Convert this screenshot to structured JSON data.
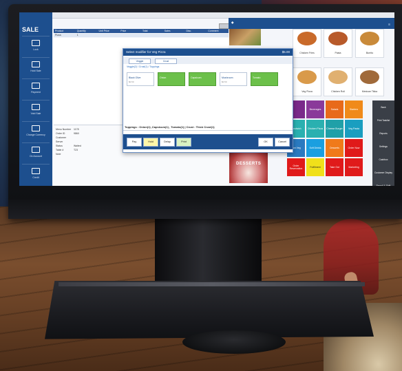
{
  "screen": {
    "app_title": "SALE",
    "top_caption": "",
    "sidebar": [
      {
        "label": "Lock",
        "icon": "cash-register-icon"
      },
      {
        "label": "Hold Sale",
        "icon": "hold-icon"
      },
      {
        "label": "Payment",
        "icon": "payment-icon"
      },
      {
        "label": "Void Sale",
        "icon": "void-icon"
      },
      {
        "label": "Change Currency",
        "icon": "grid-icon"
      },
      {
        "label": "On Account",
        "icon": "account-icon"
      },
      {
        "label": "Credit",
        "icon": "card-icon"
      }
    ],
    "order_table": {
      "headers": [
        "Product",
        "Quantity",
        "Unit Price",
        "Price",
        "Total",
        "Sales",
        "Disc.",
        "Comment"
      ],
      "rows": [
        [
          "Pizza",
          "1",
          "",
          "",
          "",
          "",
          "",
          ""
        ]
      ]
    },
    "info_panel": [
      {
        "label": "Menu Number",
        "value": "1178"
      },
      {
        "label": "Order ID",
        "value": "9860"
      },
      {
        "label": "Customer",
        "value": ""
      },
      {
        "label": "Server",
        "value": ""
      },
      {
        "label": "Status",
        "value": "Waited"
      },
      {
        "label": "Table #",
        "value": "T23"
      },
      {
        "label": "Note",
        "value": ""
      }
    ],
    "modal": {
      "title": "Select modifier for Veg Pizza",
      "price": "$5.00",
      "tabs": [
        "Veggie",
        "Crust"
      ],
      "breadcrumb": "Veggie(2) / Crust(1) / Toppings",
      "options": [
        {
          "name": "Black Olive",
          "price": "$0.50",
          "selected": false
        },
        {
          "name": "Onion",
          "price": "",
          "selected": true
        },
        {
          "name": "Capsicum",
          "price": "",
          "selected": true
        },
        {
          "name": "Mushroom",
          "price": "$0.50",
          "selected": false
        },
        {
          "name": "Tomato",
          "price": "",
          "selected": true
        }
      ],
      "summary": "Toppings : Onion(1) ,Capsicum(1) , Tomato(1)  | Crust : Thick Crust(1)",
      "actions_left": [
        "Pay",
        "Hold",
        "Delay",
        "Print"
      ],
      "actions_right": [
        "OK",
        "Cancel"
      ]
    },
    "product_panel": {
      "foods": [
        {
          "name": "",
          "color": "#8a4a2a"
        },
        {
          "name": "Chicken Fries",
          "color": "#c96a2a"
        },
        {
          "name": "Pasta",
          "color": "#b85a2a"
        },
        {
          "name": "Burrito",
          "color": "#c98a3a"
        },
        {
          "name": "Veg Pizza",
          "color": "#d99a4a"
        },
        {
          "name": "Chicken Roll",
          "color": "#e0b070"
        },
        {
          "name": "Mexican Tikka",
          "color": "#a06a3a"
        }
      ],
      "categories": [
        {
          "label": "",
          "color": "#7a2a8a"
        },
        {
          "label": "Beverages",
          "color": "#8a3a9a"
        },
        {
          "label": "Salads",
          "color": "#e86a1a"
        },
        {
          "label": "Starters",
          "color": "#f08a1a"
        },
        {
          "label": "Sandwich",
          "color": "#2ab0b0"
        },
        {
          "label": "Chicken Pizza",
          "color": "#2ab0b0"
        },
        {
          "label": "Cheese Burger",
          "color": "#20a0a8"
        },
        {
          "label": "Veg Pasta",
          "color": "#1a9ec0"
        },
        {
          "label": "Non Veg",
          "color": "#2a7ac0"
        },
        {
          "label": "Soft Drinks",
          "color": "#1a9fe0"
        },
        {
          "label": "Desserts",
          "color": "#f07a1a"
        },
        {
          "label": "Order Now",
          "color": "#e01a1a"
        },
        {
          "label": "Order Reservation",
          "color": "#e01a1a"
        },
        {
          "label": "Fulfilment",
          "color": "#f0e01a"
        },
        {
          "label": "Take Out",
          "color": "#e01a1a"
        },
        {
          "label": "Marketing",
          "color": "#e01a1a"
        }
      ],
      "side_commands": [
        "Back",
        "Print Tasklist",
        "Reports",
        "Settings",
        "Cashbox",
        "Customer Display",
        "Payroll & Shift"
      ],
      "dessert_label": "DESSERTS"
    }
  }
}
